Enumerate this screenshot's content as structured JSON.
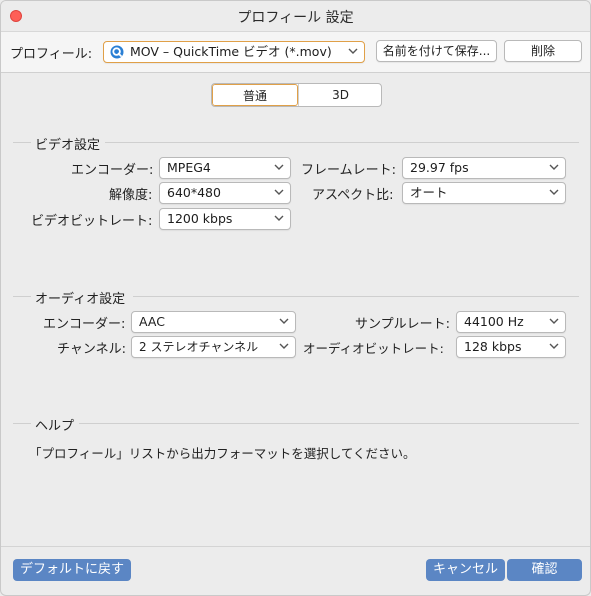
{
  "window": {
    "title": "プロフィール 設定"
  },
  "profile": {
    "label": "プロフィール:",
    "selected": "MOV – QuickTime ビデオ (*.mov)",
    "save_as_label": "名前を付けて保存...",
    "delete_label": "削除"
  },
  "tabs": [
    {
      "label": "普通",
      "active": true
    },
    {
      "label": "3D",
      "active": false
    }
  ],
  "video": {
    "title": "ビデオ設定",
    "encoder_label": "エンコーダー:",
    "encoder_value": "MPEG4",
    "framerate_label": "フレームレート:",
    "framerate_value": "29.97 fps",
    "resolution_label": "解像度:",
    "resolution_value": "640*480",
    "aspect_label": "アスペクト比:",
    "aspect_value": "オート",
    "bitrate_label": "ビデオビットレート:",
    "bitrate_value": "1200 kbps"
  },
  "audio": {
    "title": "オーディオ設定",
    "encoder_label": "エンコーダー:",
    "encoder_value": "AAC",
    "samplerate_label": "サンプルレート:",
    "samplerate_value": "44100 Hz",
    "channel_label": "チャンネル:",
    "channel_value": "2 ステレオチャンネル",
    "bitrate_label": "オーディオビットレート:",
    "bitrate_value": "128 kbps"
  },
  "help": {
    "title": "ヘルプ",
    "text": "「プロフィール」リストから出力フォーマットを選択してください。"
  },
  "footer": {
    "default_label": "デフォルトに戻す",
    "cancel_label": "キャンセル",
    "ok_label": "確認"
  },
  "colors": {
    "close_button": "#fe5f57",
    "accent_border": "#e0a048",
    "primary_button": "#5b86c4"
  },
  "icons": {
    "profile_format": "quicktime-icon",
    "dropdown": "chevron-down-icon"
  }
}
